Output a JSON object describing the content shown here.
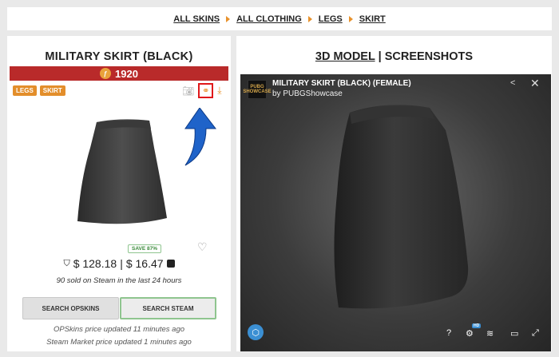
{
  "breadcrumb": {
    "items": [
      "ALL SKINS",
      "ALL CLOTHING",
      "LEGS",
      "SKIRT"
    ]
  },
  "item": {
    "title": "MILITARY SKIRT (BLACK)",
    "price_points": "1920",
    "coin_symbol": "ƒ",
    "tags": [
      "LEGS",
      "SKIRT"
    ],
    "save_badge": "SAVE 87%",
    "opskins_price": "$ 128.18",
    "price_separator": "|",
    "steam_price": "$ 16.47",
    "sold_text": "90 sold on Steam in the last 24 hours",
    "btn_opskins": "SEARCH OPSKINS",
    "btn_steam": "SEARCH STEAM",
    "opskins_updated": "OPSkins price updated 11 minutes ago",
    "steam_updated": "Steam Market price updated 1 minutes ago"
  },
  "right_panel": {
    "title_model": "3D MODEL",
    "title_sep": " | ",
    "title_screens": "SCREENSHOTS"
  },
  "viewer": {
    "logo_text": "PUBG SHOWCASE",
    "title": "MILITARY SKIRT (BLACK) (FEMALE)",
    "by": "by PUBGShowcase",
    "hd_badge": "HD",
    "help": "?"
  },
  "colors": {
    "price_bar": "#b92a2a",
    "tag": "#e38e2b",
    "highlight_box": "#e0181a",
    "arrow": "#1f63c9",
    "steam_btn_border": "#8fc58f"
  },
  "icons": {
    "camera": "camera-icon",
    "compare": "compare-icon",
    "download": "download-icon",
    "heart": "heart-icon",
    "share": "share-icon",
    "close": "close-icon",
    "settings": "gear-icon",
    "layers": "layers-icon",
    "vr": "vr-icon",
    "fullscreen": "fullscreen-icon"
  }
}
